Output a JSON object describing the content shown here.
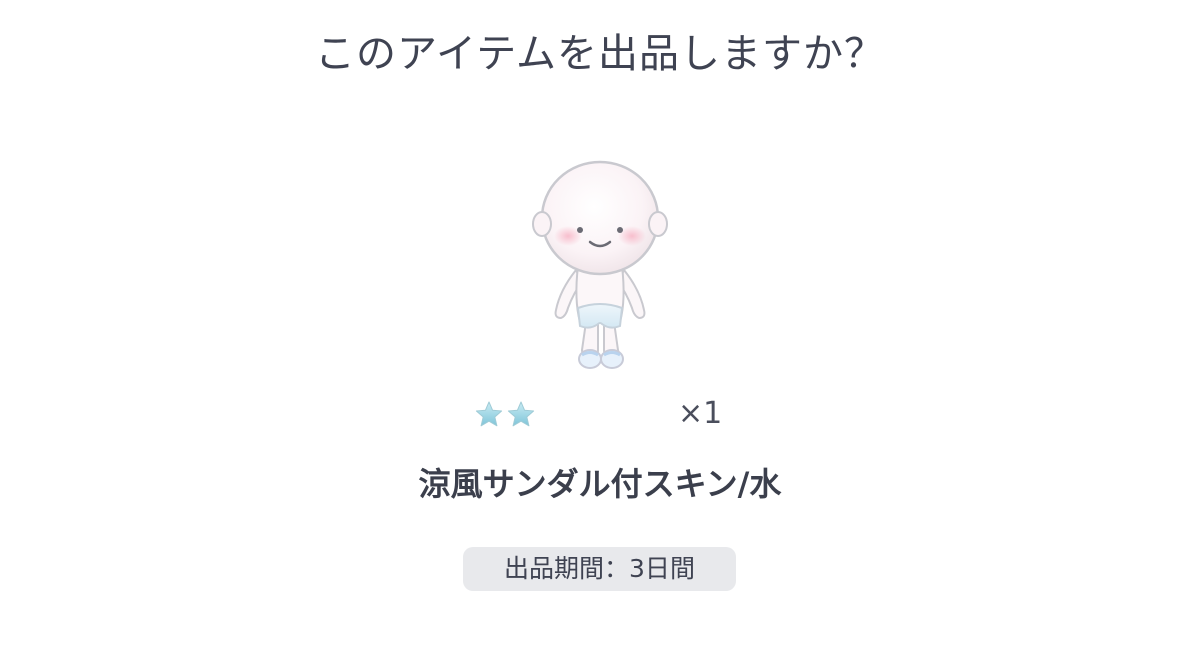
{
  "dialog": {
    "title": "このアイテムを出品しますか？",
    "item": {
      "icon": "avatar-skin-with-sandals",
      "rarity_stars": 2,
      "star_color": "#8fd0e0",
      "quantity": "×1",
      "name": "涼風サンダル付スキン/水"
    },
    "listing_period": "出品期間：3日間"
  }
}
